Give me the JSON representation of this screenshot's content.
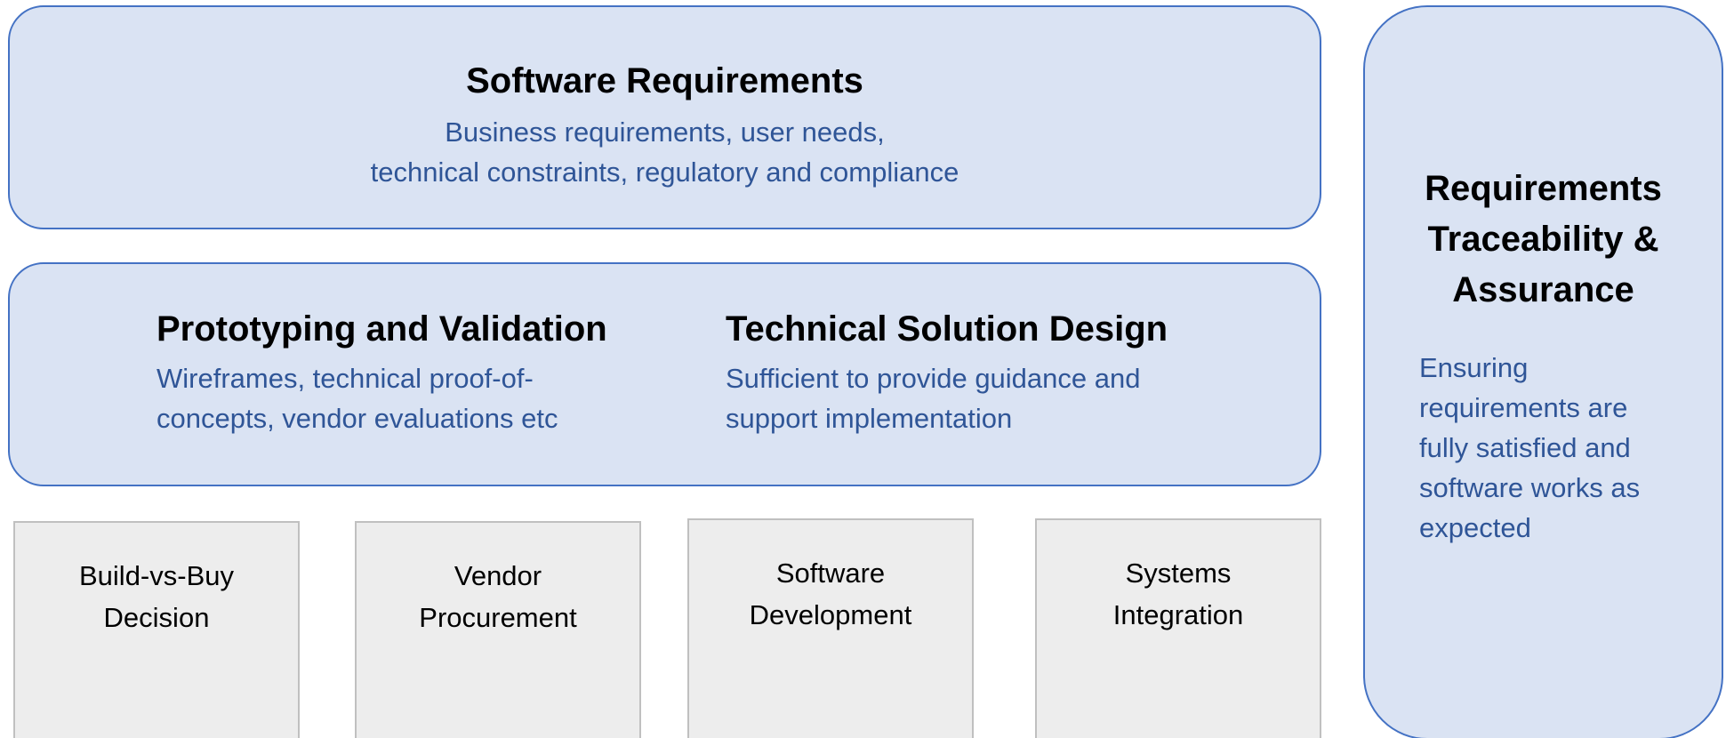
{
  "software_requirements": {
    "title": "Software Requirements",
    "description": "Business requirements, user needs,\ntechnical constraints, regulatory and compliance"
  },
  "prototyping": {
    "title": "Prototyping and Validation",
    "description": "Wireframes, technical proof-of-\nconcepts, vendor evaluations etc"
  },
  "technical_design": {
    "title": "Technical Solution Design",
    "description": "Sufficient to provide guidance and\nsupport implementation"
  },
  "traceability": {
    "title": "Requirements\nTraceability &\nAssurance",
    "description": "Ensuring\nrequirements are\nfully satisfied and\nsoftware works as\nexpected"
  },
  "activities": [
    {
      "label": "Build-vs-Buy\nDecision"
    },
    {
      "label": "Vendor\nProcurement"
    },
    {
      "label": "Software\nDevelopment"
    },
    {
      "label": "Systems\nIntegration"
    }
  ],
  "colors": {
    "panel_fill": "#dae3f3",
    "panel_border": "#4472c4",
    "description_text": "#2f5597",
    "box_fill": "#ededed",
    "box_border": "#c0c0c0"
  }
}
